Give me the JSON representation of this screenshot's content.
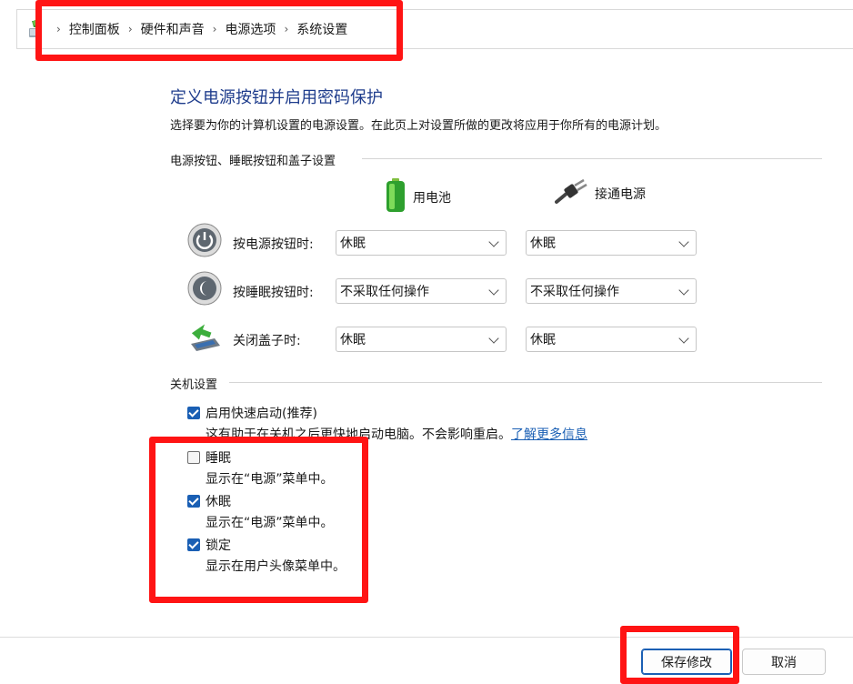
{
  "breadcrumb": {
    "icon": "control-panel-icon",
    "items": [
      "控制面板",
      "硬件和声音",
      "电源选项",
      "系统设置"
    ]
  },
  "page": {
    "title": "定义电源按钮并启用密码保护",
    "description": "选择要为你的计算机设置的电源设置。在此页上对设置所做的更改将应用于你所有的电源计划。"
  },
  "buttons_section": {
    "label": "电源按钮、睡眠按钮和盖子设置",
    "battery_label": "用电池",
    "plugged_label": "接通电源",
    "rows": [
      {
        "label": "按电源按钮时:",
        "battery": "休眠",
        "plugged": "休眠",
        "icon": "power-button-icon"
      },
      {
        "label": "按睡眠按钮时:",
        "battery": "不采取任何操作",
        "plugged": "不采取任何操作",
        "icon": "sleep-button-icon"
      },
      {
        "label": "关闭盖子时:",
        "battery": "休眠",
        "plugged": "休眠",
        "icon": "laptop-lid-icon"
      }
    ]
  },
  "shutdown_section": {
    "label": "关机设置",
    "items": [
      {
        "label": "启用快速启动(推荐)",
        "checked": true,
        "sub": "这有助于在关机之后更快地启动电脑。不会影响重启。",
        "link": "了解更多信息"
      },
      {
        "label": "睡眠",
        "checked": false,
        "sub": "显示在“电源”菜单中。"
      },
      {
        "label": "休眠",
        "checked": true,
        "sub": "显示在“电源”菜单中。"
      },
      {
        "label": "锁定",
        "checked": true,
        "sub": "显示在用户头像菜单中。"
      }
    ]
  },
  "footer": {
    "save_label": "保存修改",
    "cancel_label": "取消"
  },
  "colors": {
    "title": "#1e3c8c",
    "accent": "#1a5fb4",
    "highlight": "#ff1414"
  }
}
